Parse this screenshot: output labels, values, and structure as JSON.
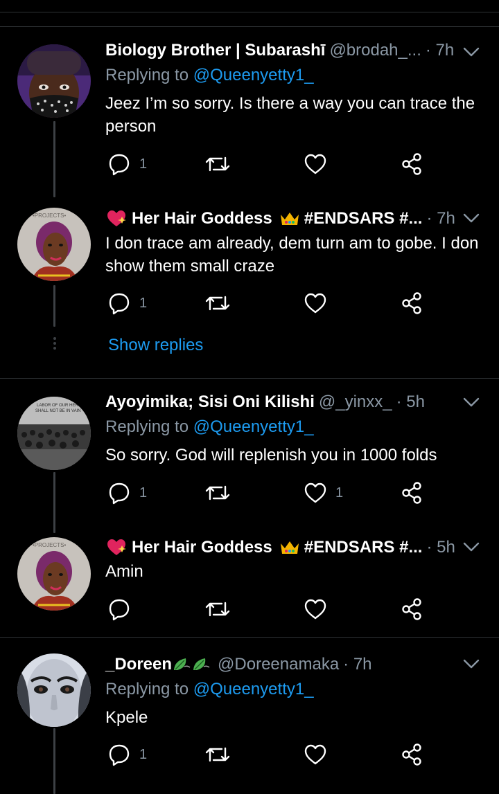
{
  "colors": {
    "background": "#000000",
    "text": "#ffffff",
    "secondary": "#8b98a5",
    "link": "#1d9bf0",
    "divider": "#2f3336"
  },
  "tweets": [
    {
      "name": "Biology Brother | Subarashī",
      "handle": "@brodah_...",
      "time": "· 7h",
      "replying_label": "Replying to ",
      "replying_to": "@Queenyetty1_",
      "text": "Jeez I’m so sorry. Is there a way you can trace the person",
      "reply_count": "1",
      "retweet_count": "",
      "like_count": "",
      "avatar_icon": "masked-man-avatar"
    },
    {
      "name": "Her Hair Goddess",
      "name_suffix": "#ENDSARS #...",
      "handle": "",
      "time": "· 7h",
      "text": "I don trace am already, dem turn am to gobe. I don show them small craze",
      "reply_count": "1",
      "retweet_count": "",
      "like_count": "",
      "avatar_icon": "woman-selfie-avatar",
      "name_emojis": [
        "heart-icon",
        "crown-icon"
      ]
    },
    {
      "name": "Ayoyimika; Sisi Oni Kilishi",
      "handle": "@_yinxx_",
      "time": "· 5h",
      "replying_label": "Replying to ",
      "replying_to": "@Queenyetty1_",
      "text": "So sorry. God will replenish you in 1000 folds",
      "reply_count": "1",
      "retweet_count": "",
      "like_count": "1",
      "avatar_icon": "crowd-protest-avatar"
    },
    {
      "name": "Her Hair Goddess",
      "name_suffix": "#ENDSARS #...",
      "handle": "",
      "time": "· 5h",
      "text": "Amin",
      "reply_count": "",
      "retweet_count": "",
      "like_count": "",
      "avatar_icon": "woman-selfie-avatar",
      "name_emojis": [
        "heart-icon",
        "crown-icon"
      ]
    },
    {
      "name": "_Doreen",
      "handle": "@Doreenamaka",
      "time": "· 7h",
      "replying_label": "Replying to ",
      "replying_to": "@Queenyetty1_",
      "text": "Kpele",
      "reply_count": "1",
      "retweet_count": "",
      "like_count": "",
      "avatar_icon": "face-art-avatar",
      "name_emojis": [
        "leaves-icon",
        "leaves-icon"
      ]
    }
  ],
  "show_replies": "Show replies"
}
